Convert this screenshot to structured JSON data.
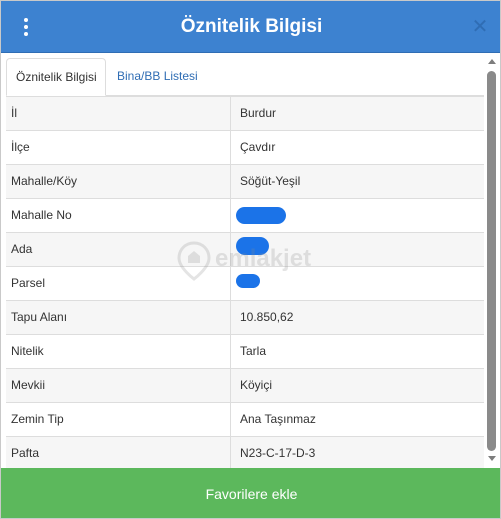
{
  "header": {
    "title": "Öznitelik Bilgisi",
    "menu_icon": "kebab-menu-icon",
    "close_label": "✕"
  },
  "tabs": [
    {
      "label": "Öznitelik Bilgisi",
      "active": true
    },
    {
      "label": "Bina/BB Listesi",
      "active": false
    }
  ],
  "attributes": [
    {
      "key": "İl",
      "value": "Burdur"
    },
    {
      "key": "İlçe",
      "value": "Çavdır"
    },
    {
      "key": "Mahalle/Köy",
      "value": "Söğüt-Yeşil"
    },
    {
      "key": "Mahalle No",
      "value": "",
      "redacted": true
    },
    {
      "key": "Ada",
      "value": "",
      "redacted": true
    },
    {
      "key": "Parsel",
      "value": "",
      "redacted": true
    },
    {
      "key": "Tapu Alanı",
      "value": "10.850,62"
    },
    {
      "key": "Nitelik",
      "value": "Tarla"
    },
    {
      "key": "Mevkii",
      "value": "Köyiçi"
    },
    {
      "key": "Zemin Tip",
      "value": "Ana Taşınmaz"
    },
    {
      "key": "Pafta",
      "value": "N23-C-17-D-3"
    }
  ],
  "watermark": {
    "text": "emlakjet"
  },
  "footer": {
    "button_label": "Favorilere ekle"
  },
  "colors": {
    "header": "#3d82d0",
    "footer": "#5cb85c",
    "link": "#2f6db4",
    "redaction": "#1b73e8"
  }
}
